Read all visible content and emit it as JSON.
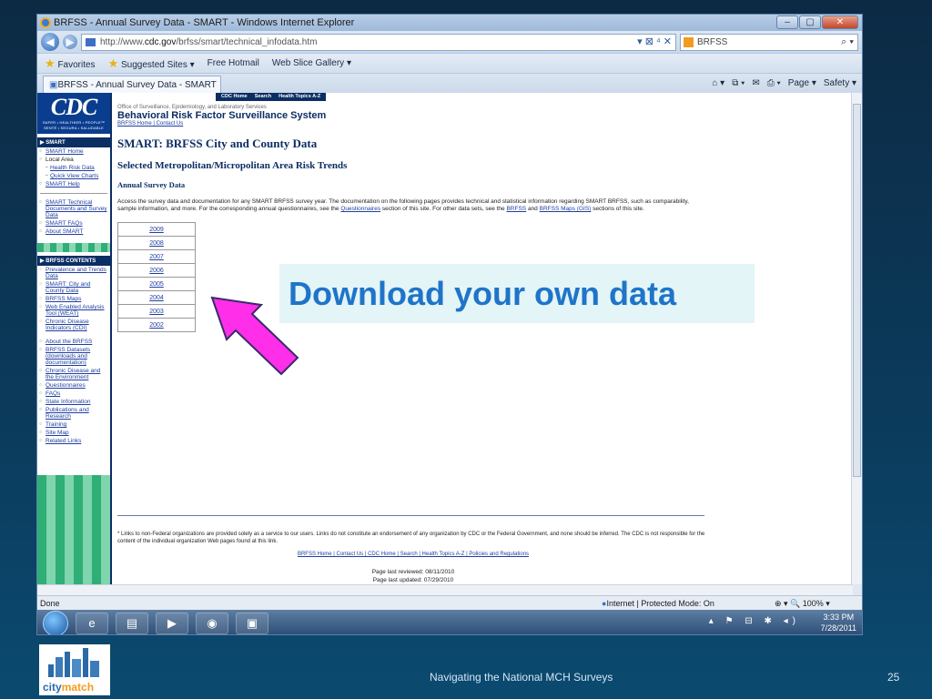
{
  "window": {
    "title": "BRFSS - Annual Survey Data - SMART - Windows Internet Explorer",
    "controls": [
      "–",
      "▢",
      "✕"
    ]
  },
  "address": {
    "url_prefix": "http://www.",
    "url_domain": "cdc.gov",
    "url_path": "/brfss/smart/technical_infodata.htm",
    "tools": "▾ ⊠ ⁴ ✕",
    "search_engine": "BRFSS",
    "back": "◀",
    "forward": "▶"
  },
  "favorites_bar": {
    "favorites": "Favorites",
    "suggested": "Suggested Sites ▾",
    "hotmail": "Free Hotmail",
    "webslice": "Web Slice Gallery ▾"
  },
  "tab": {
    "title": "BRFSS - Annual Survey Data - SMART"
  },
  "command_bar": {
    "home": "⌂ ▾",
    "feeds": "⧉ ▾",
    "mail": "✉",
    "print": "⎙ ▾",
    "page": "Page ▾",
    "safety": "Safety ▾"
  },
  "cdc": {
    "logo": "CDC",
    "logo_tag": "SAFER • HEALTHIER • PEOPLE™ SENTÉ • SEGURA • SALUDABLE",
    "topnav": [
      "CDC Home",
      "Search",
      "Health Topics A-Z"
    ],
    "office": "Office of Surveillance, Epidemiology, and Laboratory Services",
    "system_title": "Behavioral Risk Factor Surveillance System",
    "header_links": "BRFSS Home | Contact Us",
    "smart_section": "▶ SMART",
    "smart_links": [
      {
        "label": "SMART Home",
        "style": "link"
      },
      {
        "label": "Local Area",
        "style": "plain"
      },
      {
        "label": "Health Risk Data",
        "style": "sub"
      },
      {
        "label": "Quick View Charts",
        "style": "sub"
      },
      {
        "label": "SMART Help",
        "style": "link"
      }
    ],
    "smart_links2": [
      "SMART Technical Documents and Survey Data",
      "SMART FAQs",
      "About SMART"
    ],
    "brfss_section": "▶ BRFSS CONTENTS",
    "brfss_links": [
      "Prevalence and Trends Data",
      "SMART: City and County Data",
      "BRFSS Maps",
      "Web Enabled Analysis Tool (WEAT)",
      "Chronic Disease Indicators (CDI)",
      "About the BRFSS",
      "BRFSS Datasets (downloads and documentation)",
      "Chronic Disease and the Environment",
      "Questionnaires",
      "FAQs",
      "State Information",
      "Publications and Research",
      "Training",
      "Site Map",
      "Related Links"
    ],
    "page_title": "SMART: BRFSS City and County Data",
    "subtitle": "Selected Metropolitan/Micropolitan Area Risk Trends",
    "section_title": "Annual Survey Data",
    "intro_before": "Access the survey data and documentation for any SMART BRFSS survey year. The documentation on the following pages provides technical and statistical information regarding SMART BRFSS, such as comparability, sample information, and more. For the corresponding annual questionnaires, see the ",
    "intro_link1": "Questionnaires",
    "intro_mid": " section of this site. For other data sets, see the ",
    "intro_link2": "BRFSS",
    "intro_and": " and ",
    "intro_link3": "BRFSS Maps (GIS)",
    "intro_after": " sections of this site.",
    "years": [
      "2009",
      "2008",
      "2007",
      "2006",
      "2005",
      "2004",
      "2003",
      "2002"
    ],
    "footnote": "* Links to non-Federal organizations are provided solely as a service to our users. Links do not constitute an endorsement of any organization by CDC or the Federal Government, and none should be inferred. The CDC is not responsible for the content of the individual organization Web pages found at this link.",
    "footer_links": "BRFSS Home | Contact Us | CDC Home | Search | Health Topics A-Z | Policies and Regulations",
    "reviewed": "Page last reviewed: 08/11/2010",
    "updated": "Page last updated: 07/29/2010"
  },
  "status": {
    "left": "Done",
    "zone": "Internet | Protected Mode: On",
    "zoom": "⊕ ▾  🔍 100%  ▾"
  },
  "taskbar": {
    "time": "3:33 PM",
    "date": "7/28/2011",
    "tray_icons": "▴ ⚑ ⊟ ✱ ◂)"
  },
  "slide": {
    "callout": "Download your own data",
    "footer": "Navigating the National MCH Surveys",
    "slide_number": "25",
    "logo_city": "city",
    "logo_match": "match",
    "callout_bg": "#e3f5f6",
    "callout_color": "#1f74c9",
    "arrow_color": "#ff2ee8"
  }
}
